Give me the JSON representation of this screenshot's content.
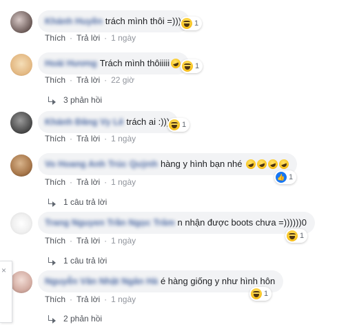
{
  "actions": {
    "like": "Thích",
    "reply": "Trả lời",
    "dot": "·"
  },
  "comments": [
    {
      "name": "Khánh Huyền",
      "text": "trách mình thôi =)))",
      "reaction": {
        "icon": "haha-icon",
        "count": "1"
      },
      "time": "1 ngày",
      "replies": null
    },
    {
      "name": "Hoài Hương",
      "text": "Trách mình thôiiiii",
      "reaction": {
        "icon": "haha-icon",
        "count": "1"
      },
      "time": "22 giờ",
      "replies": "3 phản hồi"
    },
    {
      "name": "Khánh Đăng Vy Lê",
      "text": "trách ai :)))",
      "reaction": {
        "icon": "haha-icon",
        "count": "1"
      },
      "time": "1 ngày",
      "replies": null
    },
    {
      "name": "Vo Hoang Anh Trúc Quỳnh",
      "text": "hàng y hình bạn nhé",
      "reaction": {
        "icon": "like-icon",
        "count": "1"
      },
      "time": "1 ngày",
      "replies": "1 câu trả lời"
    },
    {
      "name": "Trang Nguyen Trần Ngọc Trâm",
      "text": "n nhận được boots chưa =))))))0",
      "reaction": {
        "icon": "haha-icon",
        "count": "1"
      },
      "time": "1 ngày",
      "replies": "1 câu trả lời"
    },
    {
      "name": "Nguyễn Văn Nhật Ngân Hà",
      "text": "é hàng giống y như hình hôn",
      "reaction": {
        "icon": "haha-icon",
        "count": "1"
      },
      "time": "1 ngày",
      "replies": "2 phản hồi"
    }
  ],
  "side_popup": {
    "close": "×"
  },
  "colors": {
    "bubble": "#f2f3f5",
    "name": "#385898",
    "link": "#4b4f56",
    "like": "#1877f2"
  }
}
